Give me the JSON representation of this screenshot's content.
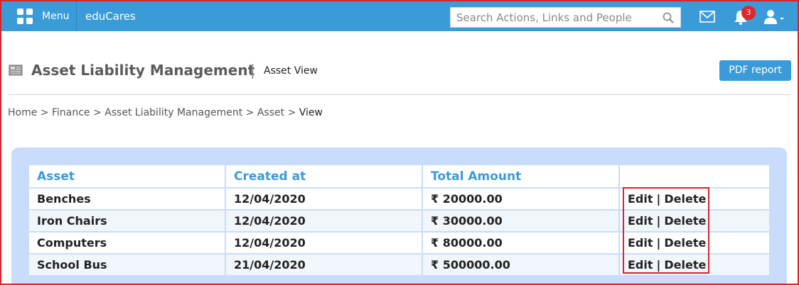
{
  "topbar": {
    "menu_label": "Menu",
    "brand": "eduCares",
    "search_placeholder": "Search Actions, Links and People",
    "notification_count": "3",
    "icons": [
      "grid-icon",
      "search-icon",
      "mail-icon",
      "bell-icon",
      "user-icon"
    ]
  },
  "header": {
    "title": "Asset Liability Management",
    "separator": "|",
    "subtitle": "Asset View",
    "pdf_button": "PDF report"
  },
  "breadcrumb": {
    "items": [
      "Home",
      "Finance",
      "Asset Liability Management",
      "Asset",
      "View"
    ],
    "separator": ">"
  },
  "table": {
    "columns": [
      "Asset",
      "Created at",
      "Total Amount",
      ""
    ],
    "rows": [
      {
        "asset": "Benches",
        "created_at": "12/04/2020",
        "amount": "₹ 20000.00",
        "edit": "Edit",
        "delete": "Delete"
      },
      {
        "asset": "Iron Chairs",
        "created_at": "12/04/2020",
        "amount": "₹ 30000.00",
        "edit": "Edit",
        "delete": "Delete"
      },
      {
        "asset": "Computers",
        "created_at": "12/04/2020",
        "amount": "₹ 80000.00",
        "edit": "Edit",
        "delete": "Delete"
      },
      {
        "asset": "School Bus",
        "created_at": "21/04/2020",
        "amount": "₹ 500000.00",
        "edit": "Edit",
        "delete": "Delete"
      }
    ],
    "action_separator": "|"
  },
  "colors": {
    "topbar": "#3a9bd8",
    "header_text": "#3a9bd8",
    "panel": "#c9dcfb",
    "highlight_border": "#d9232b",
    "badge": "#e0262c"
  }
}
